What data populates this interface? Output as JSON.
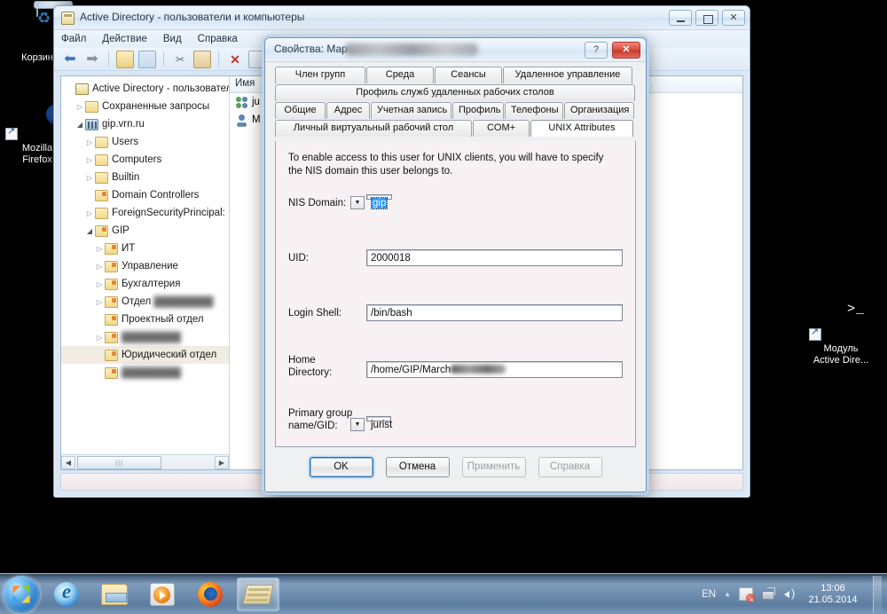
{
  "desktop": {
    "icons": [
      {
        "name": "recycle-bin",
        "label": "Корзин"
      },
      {
        "name": "firefox",
        "label": "Mozilla\nFirefox"
      },
      {
        "name": "ad-module",
        "label": "Модуль\nActive Dire..."
      }
    ],
    "firefox_label_line1": "Mozilla",
    "firefox_label_line2": "Firefox",
    "admodule_label_line1": "Модуль",
    "admodule_label_line2": "Active Dire...",
    "recycle_label": "Корзин"
  },
  "mmc_window": {
    "title": "Active Directory - пользователи и компьютеры",
    "menu": [
      "Файл",
      "Действие",
      "Вид",
      "Справка"
    ],
    "window_buttons": {
      "minimize": "minimize",
      "restore": "restore",
      "close": "close"
    },
    "toolbar_icons": [
      "back-icon",
      "forward-icon",
      "up-folder-icon",
      "show-pane-icon",
      "cut-icon",
      "paste-icon",
      "delete-icon",
      "properties-icon",
      "refresh-icon"
    ],
    "tree": [
      {
        "label": "Active Directory - пользователи",
        "level": 0,
        "expander": "none",
        "icon": "console-root-icon",
        "blurred": false,
        "selected": false
      },
      {
        "label": "Сохраненные запросы",
        "level": 1,
        "expander": "collapsed",
        "icon": "folder-icon",
        "blurred": false,
        "selected": false
      },
      {
        "label": "gip.vrn.ru",
        "level": 1,
        "expander": "expanded",
        "icon": "domain-icon",
        "blurred": false,
        "selected": false
      },
      {
        "label": "Users",
        "level": 2,
        "expander": "collapsed",
        "icon": "folder-icon",
        "blurred": false,
        "selected": false
      },
      {
        "label": "Computers",
        "level": 2,
        "expander": "collapsed",
        "icon": "folder-icon",
        "blurred": false,
        "selected": false
      },
      {
        "label": "Builtin",
        "level": 2,
        "expander": "collapsed",
        "icon": "folder-icon",
        "blurred": false,
        "selected": false
      },
      {
        "label": "Domain Controllers",
        "level": 2,
        "expander": "none",
        "icon": "ou-icon",
        "blurred": false,
        "selected": false
      },
      {
        "label": "ForeignSecurityPrincipal:",
        "level": 2,
        "expander": "collapsed",
        "icon": "folder-icon",
        "blurred": false,
        "selected": false
      },
      {
        "label": "GIP",
        "level": 2,
        "expander": "expanded",
        "icon": "ou-icon",
        "blurred": false,
        "selected": false
      },
      {
        "label": "ИТ",
        "level": 3,
        "expander": "collapsed",
        "icon": "ou-icon",
        "blurred": false,
        "selected": false
      },
      {
        "label": "Управление",
        "level": 3,
        "expander": "collapsed",
        "icon": "ou-icon",
        "blurred": false,
        "selected": false
      },
      {
        "label": "Бухгалтерия",
        "level": 3,
        "expander": "collapsed",
        "icon": "ou-icon",
        "blurred": false,
        "selected": false
      },
      {
        "label": "Отдел",
        "level": 3,
        "expander": "collapsed",
        "icon": "ou-icon",
        "blurred": true,
        "selected": false
      },
      {
        "label": "Проектный отдел",
        "level": 3,
        "expander": "none",
        "icon": "ou-icon",
        "blurred": false,
        "selected": false
      },
      {
        "label": "",
        "level": 3,
        "expander": "collapsed",
        "icon": "ou-icon",
        "blurred": true,
        "selected": false
      },
      {
        "label": "Юридический отдел",
        "level": 3,
        "expander": "none",
        "icon": "ou-icon",
        "blurred": false,
        "selected": true
      },
      {
        "label": "",
        "level": 3,
        "expander": "none",
        "icon": "ou-icon",
        "blurred": true,
        "selected": false
      }
    ],
    "list_pane": {
      "columns": [
        "Имя"
      ],
      "rows": [
        {
          "icon": "group-icon",
          "label": "ju"
        },
        {
          "icon": "user-icon",
          "label": "M"
        }
      ]
    },
    "scrollbar": {
      "left_arrow": "◀",
      "right_arrow": "▶"
    }
  },
  "dialog": {
    "title": "Свойства: Мар",
    "help_button": "?",
    "close_button": "✕",
    "tabs_row1": [
      "Член групп",
      "Среда",
      "Сеансы",
      "Удаленное управление"
    ],
    "tabs_row2": [
      "Профиль служб удаленных рабочих столов"
    ],
    "tabs_row3": [
      "Общие",
      "Адрес",
      "Учетная запись",
      "Профиль",
      "Телефоны",
      "Организация"
    ],
    "tabs_row4": [
      "Личный виртуальный рабочий стол",
      "COM+",
      "UNIX Attributes"
    ],
    "active_tab": "UNIX Attributes",
    "hint": "To enable access to this user for UNIX clients, you will have to specify the NIS domain this user belongs to.",
    "fields": {
      "nis_domain": {
        "label": "NIS Domain:",
        "value": "gip",
        "type": "combobox",
        "focused": true,
        "selected": true
      },
      "uid": {
        "label": "UID:",
        "value": "2000018",
        "type": "textbox"
      },
      "login_shell": {
        "label": "Login Shell:",
        "value": "/bin/bash",
        "type": "textbox"
      },
      "home_directory": {
        "label": "Home\nDirectory:",
        "label_line1": "Home",
        "label_line2": "Directory:",
        "value": "/home/GIP/March",
        "type": "textbox"
      },
      "primary_group": {
        "label": "Primary group\nname/GID:",
        "label_line1": "Primary group",
        "label_line2": "name/GID:",
        "value": "jurist",
        "type": "combobox"
      }
    },
    "buttons": [
      {
        "label": "OK",
        "state": "default"
      },
      {
        "label": "Отмена",
        "state": "enabled"
      },
      {
        "label": "Применить",
        "state": "disabled"
      },
      {
        "label": "Справка",
        "state": "disabled"
      }
    ]
  },
  "taskbar": {
    "start_button": "start-orb",
    "items": [
      {
        "name": "internet-explorer",
        "running": false
      },
      {
        "name": "windows-explorer",
        "running": false
      },
      {
        "name": "windows-media-player",
        "running": false
      },
      {
        "name": "firefox",
        "running": false
      },
      {
        "name": "active-directory-console",
        "running": true
      }
    ],
    "tray": {
      "language": "EN",
      "chevron": "▲",
      "icons": [
        "action-center-flag-icon",
        "network-icon",
        "volume-icon"
      ],
      "time": "13:06",
      "date": "21.05.2014"
    }
  },
  "colors": {
    "selection_blue": "#2a94f0",
    "focus_orange": "#e98a36",
    "dialog_bg": "#f7f1f4",
    "desktop_bg": "#000000"
  }
}
